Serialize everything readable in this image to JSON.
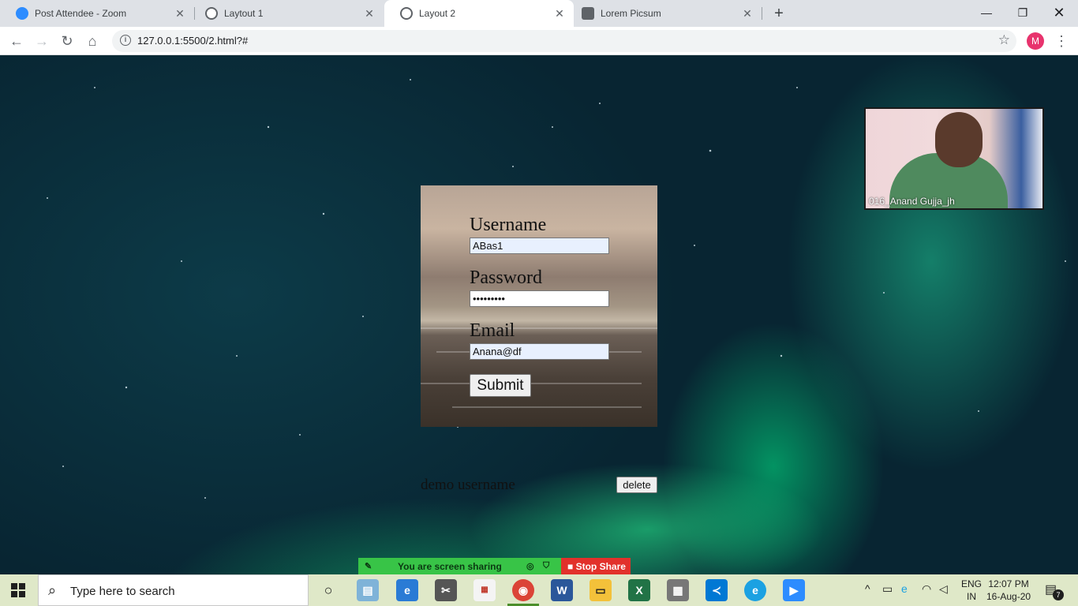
{
  "browser": {
    "tabs": [
      {
        "label": "Post Attendee - Zoom",
        "icon": "zoom-icon"
      },
      {
        "label": "Laytout 1",
        "icon": "globe-icon"
      },
      {
        "label": "Layout 2",
        "icon": "globe-icon",
        "active": true
      },
      {
        "label": "Lorem Picsum",
        "icon": "picsum-icon"
      }
    ],
    "url": "127.0.0.1:5500/2.html?#",
    "profile_initial": "M"
  },
  "form": {
    "username_label": "Username",
    "username_value": "ABas1",
    "password_label": "Password",
    "password_value": "•••••••••",
    "email_label": "Email",
    "email_value": "Anana@df",
    "submit_label": "Submit"
  },
  "list": {
    "item_name": "demo username",
    "delete_label": "delete"
  },
  "webcam": {
    "participant_name": "016_Anand Gujja_jh"
  },
  "screen_share": {
    "message": "You are screen sharing",
    "stop_label": "Stop Share"
  },
  "taskbar": {
    "search_placeholder": "Type here to search",
    "lang_line1": "ENG",
    "lang_line2": "IN",
    "time": "12:07 PM",
    "date": "16-Aug-20",
    "notification_count": "7"
  },
  "colors": {
    "zoom_blue": "#2d8cff",
    "share_green": "#38c447",
    "stop_red": "#e2312b",
    "avatar_pink": "#e8336d"
  }
}
